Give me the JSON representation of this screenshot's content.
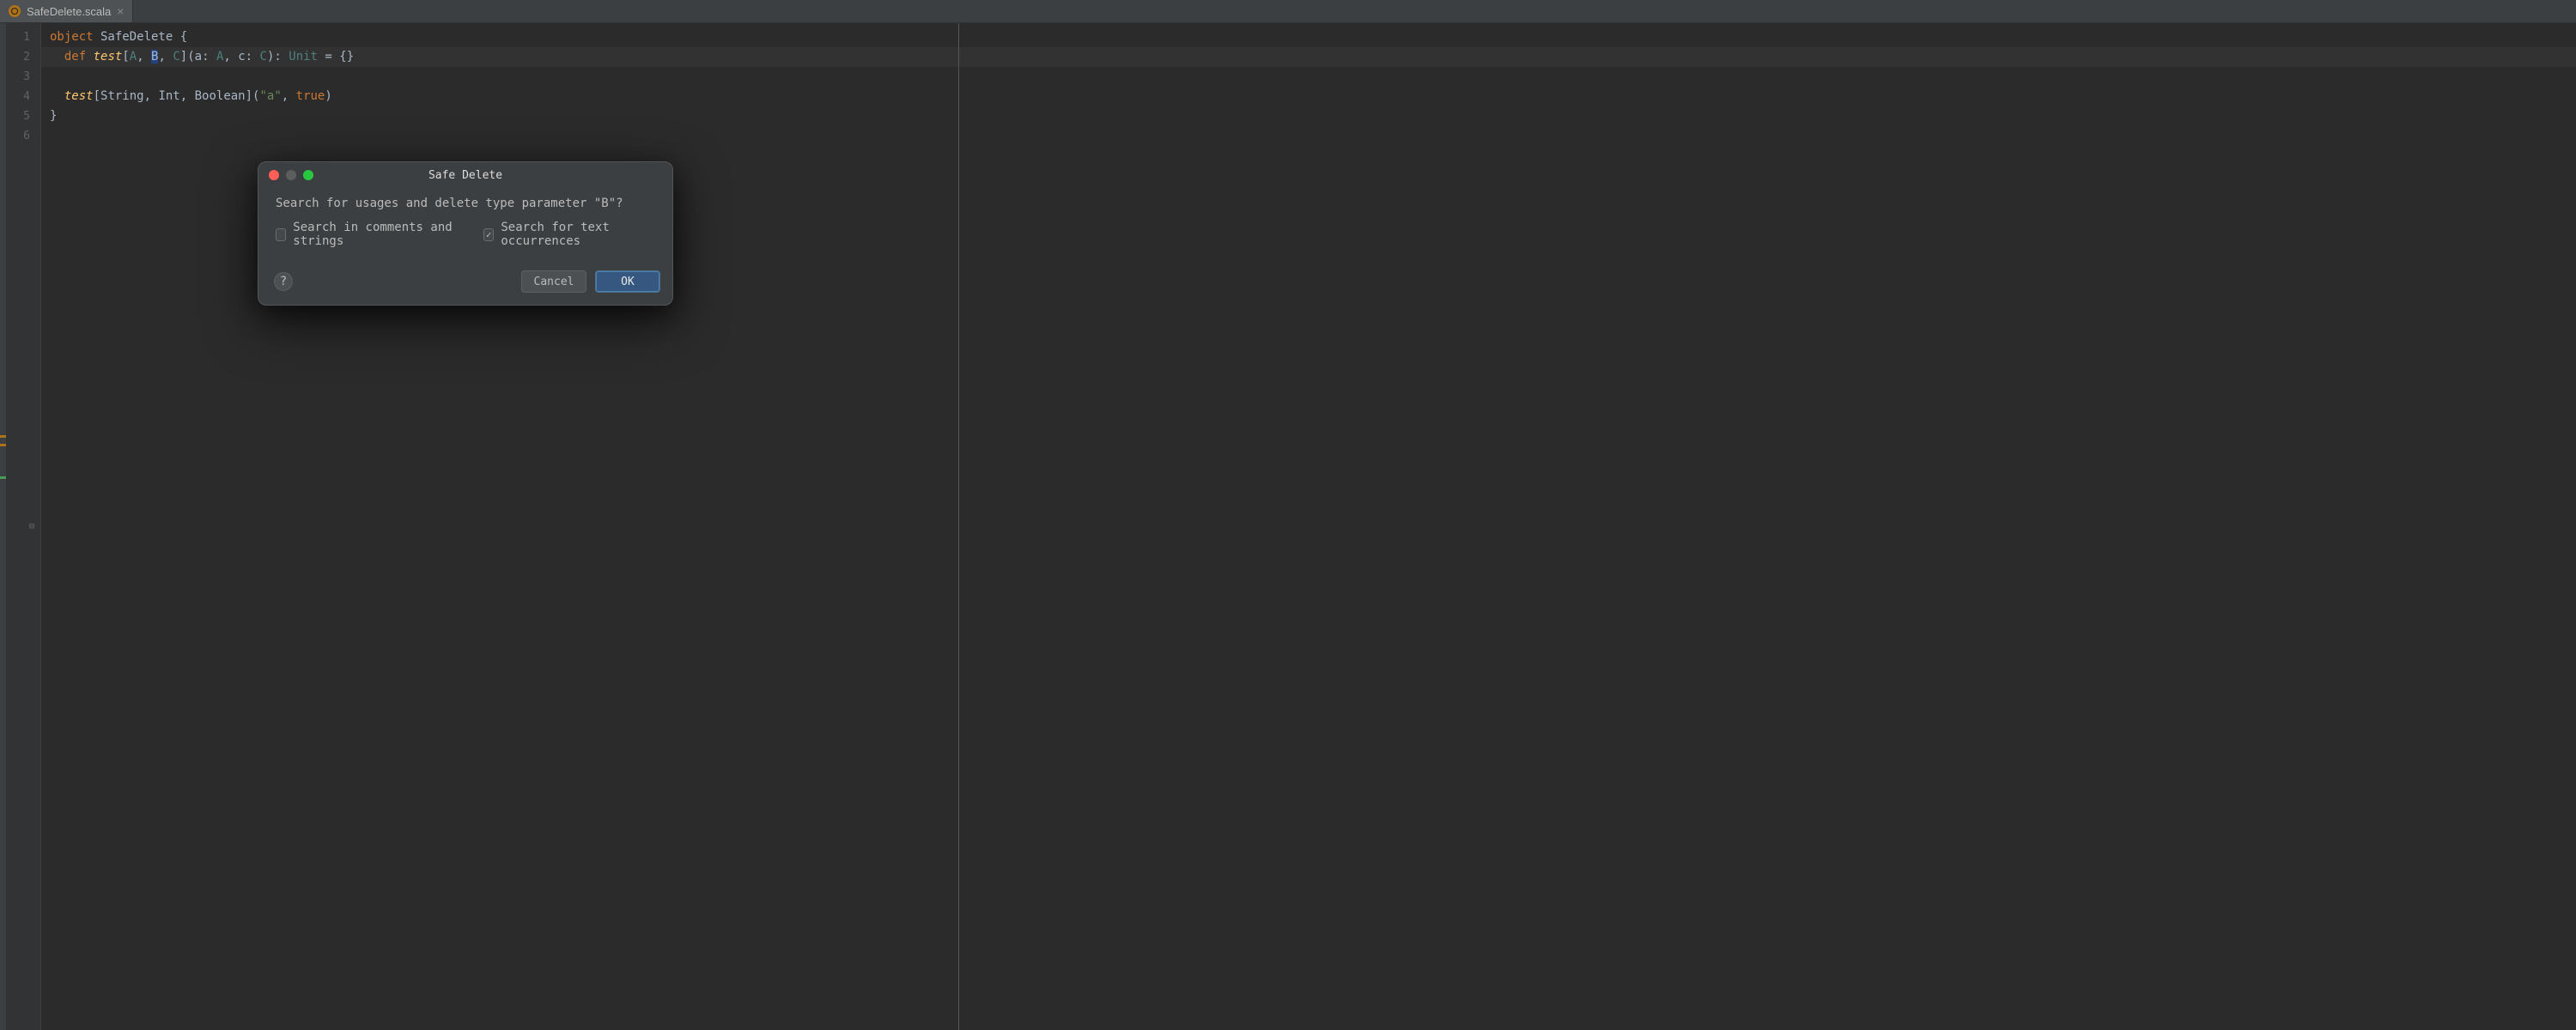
{
  "tab": {
    "filename": "SafeDelete.scala",
    "close_glyph": "×"
  },
  "gutter": {
    "lines": [
      "1",
      "2",
      "3",
      "4",
      "5",
      "6"
    ]
  },
  "code": {
    "l1": {
      "kw": "object",
      "name": " SafeDelete {"
    },
    "l2": {
      "indent": "  ",
      "kw": "def",
      "fn": " test",
      "open": "[",
      "A": "A",
      "c1": ", ",
      "B": "B",
      "c2": ", ",
      "C": "C",
      "close_sig1": "](a: ",
      "A2": "A",
      "c3": ", c: ",
      "C2": "C",
      "close_sig2": "): ",
      "Unit": "Unit",
      "eq": " = {}"
    },
    "l4": {
      "indent": "  ",
      "call": "test",
      "open": "[",
      "String": "String",
      "c1": ", ",
      "Int": "Int",
      "c2": ", ",
      "Boolean": "Boolean",
      "close": "](",
      "arg1": "\"a\"",
      "c3": ", ",
      "arg2": "true",
      "end": ")"
    },
    "l5": "}"
  },
  "dialog": {
    "title": "Safe Delete",
    "message": "Search for usages and delete type parameter \"B\"?",
    "opt_comments": {
      "label": "Search in comments and strings",
      "checked": false
    },
    "opt_text": {
      "label": "Search for text occurrences",
      "checked": true
    },
    "help": "?",
    "cancel": "Cancel",
    "ok": "OK"
  }
}
